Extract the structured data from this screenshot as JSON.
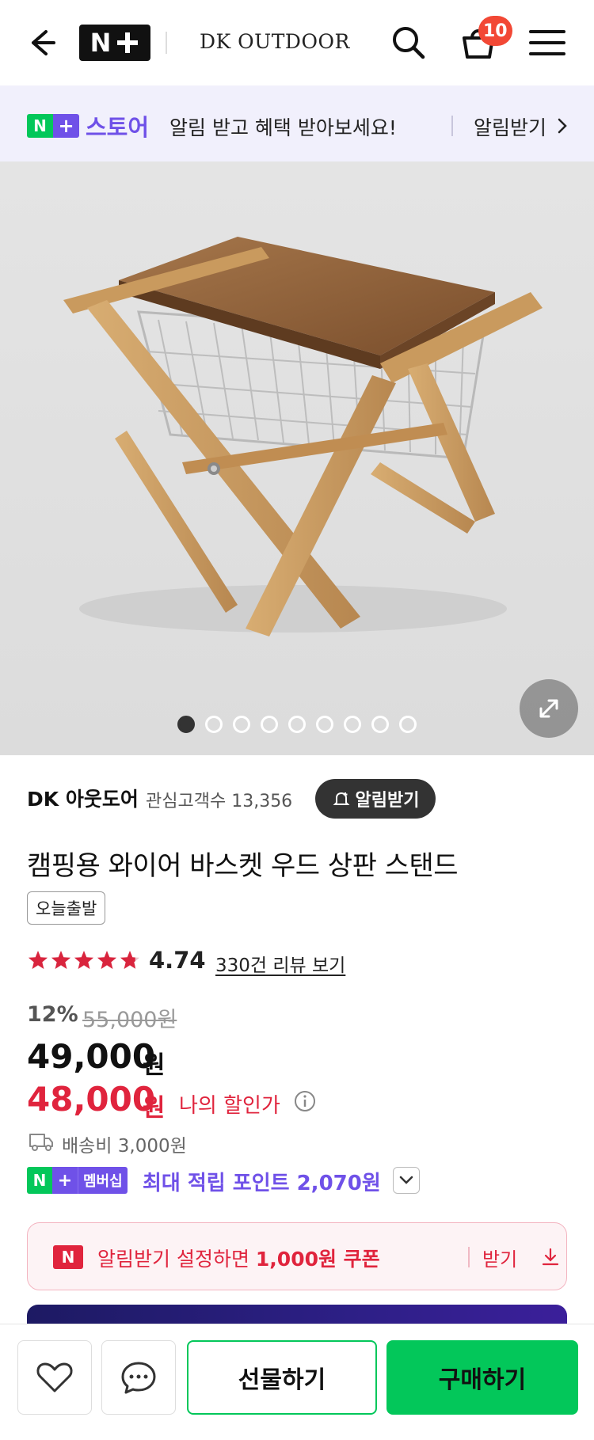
{
  "header": {
    "brand": "DK OUTDOOR",
    "cart_count": "10",
    "nplus_text": "N"
  },
  "store_banner": {
    "logo_n": "N",
    "logo_plus": "+",
    "store": "스토어",
    "message": "알림 받고 혜택 받아보세요!",
    "action": "알림받기"
  },
  "gallery": {
    "total_images": 9,
    "current_index": 1
  },
  "seller": {
    "name": "DK 아웃도어",
    "followers_label": "관심고객수",
    "followers_count": "13,356",
    "alert_button": "알림받기"
  },
  "product": {
    "title": "캠핑용 와이어 바스켓 우드 상판 스탠드",
    "badge": "오늘출발",
    "rating_stars": 4.74,
    "rating": "4.74",
    "reviews_link": "330건 리뷰 보기",
    "discount_rate": "12%",
    "original_price": "55,000원",
    "price": "49,000",
    "price_unit": "원",
    "my_price": "48,000",
    "my_price_unit": "원",
    "my_price_label": "나의 할인가",
    "shipping": "배송비 3,000원"
  },
  "membership": {
    "logo_n": "N",
    "logo_plus": "+",
    "badge": "멤버십",
    "points": "최대 적립 포인트 2,070원"
  },
  "coupon": {
    "logo": "N",
    "text_prefix": "알림받기 설정하면 ",
    "text_bold": "1,000원 쿠폰",
    "action": "받기"
  },
  "bottom_bar": {
    "gift": "선물하기",
    "buy": "구매하기"
  },
  "colors": {
    "naver_green": "#03c75a",
    "nplus_purple": "#6f51e8",
    "sale_red": "#e0243d",
    "badge_red": "#f24835"
  }
}
